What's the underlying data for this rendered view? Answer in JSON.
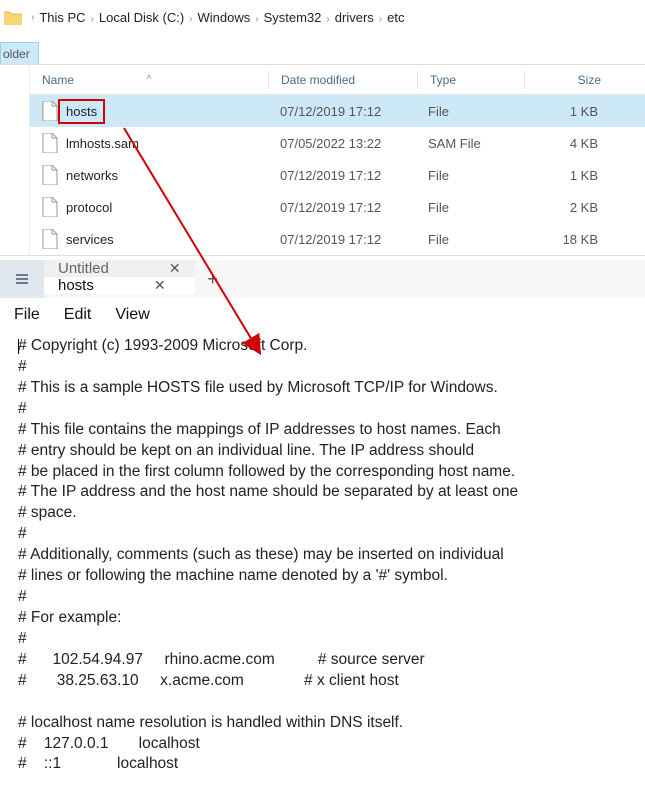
{
  "explorer": {
    "breadcrumb": [
      "This PC",
      "Local Disk (C:)",
      "Windows",
      "System32",
      "drivers",
      "etc"
    ],
    "ribbon_button": "older",
    "columns": {
      "name": "Name",
      "date": "Date modified",
      "type": "Type",
      "size": "Size"
    },
    "files": [
      {
        "name": "hosts",
        "date": "07/12/2019 17:12",
        "type": "File",
        "size": "1 KB",
        "selected": true,
        "highlight": true
      },
      {
        "name": "lmhosts.sam",
        "date": "07/05/2022 13:22",
        "type": "SAM File",
        "size": "4 KB",
        "selected": false,
        "highlight": false
      },
      {
        "name": "networks",
        "date": "07/12/2019 17:12",
        "type": "File",
        "size": "1 KB",
        "selected": false,
        "highlight": false
      },
      {
        "name": "protocol",
        "date": "07/12/2019 17:12",
        "type": "File",
        "size": "2 KB",
        "selected": false,
        "highlight": false
      },
      {
        "name": "services",
        "date": "07/12/2019 17:12",
        "type": "File",
        "size": "18 KB",
        "selected": false,
        "highlight": false
      }
    ]
  },
  "notepad": {
    "tabs": [
      {
        "title": "Untitled",
        "active": false
      },
      {
        "title": "hosts",
        "active": true
      }
    ],
    "menu": [
      "File",
      "Edit",
      "View"
    ],
    "lines": [
      "# Copyright (c) 1993-2009 Microsoft Corp.",
      "#",
      "# This is a sample HOSTS file used by Microsoft TCP/IP for Windows.",
      "#",
      "# This file contains the mappings of IP addresses to host names. Each",
      "# entry should be kept on an individual line. The IP address should",
      "# be placed in the first column followed by the corresponding host name.",
      "# The IP address and the host name should be separated by at least one",
      "# space.",
      "#",
      "# Additionally, comments (such as these) may be inserted on individual",
      "# lines or following the machine name denoted by a '#' symbol.",
      "#",
      "# For example:",
      "#",
      "#      102.54.94.97     rhino.acme.com          # source server",
      "#       38.25.63.10     x.acme.com              # x client host",
      "",
      "# localhost name resolution is handled within DNS itself.",
      "#    127.0.0.1       localhost",
      "#    ::1             localhost"
    ]
  }
}
